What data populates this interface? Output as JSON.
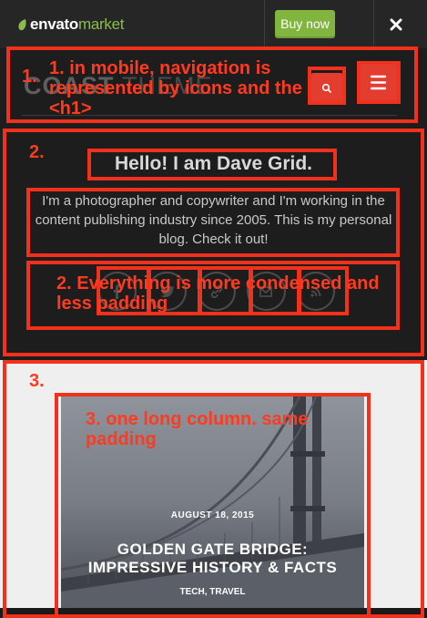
{
  "envato": {
    "logo_bold": "envato",
    "logo_light": "market",
    "buy_label": "Buy now"
  },
  "header": {
    "title_bold": "COAST",
    "title_light": "THEME"
  },
  "hero": {
    "title": "Hello! I am Dave Grid.",
    "text": "I'm a photographer and copywriter and I'm working in the content publishing industry since 2005. This is my personal blog. Check it out!",
    "social_icons": [
      "facebook-icon",
      "twitter-icon",
      "link-icon",
      "email-icon",
      "feed-icon"
    ]
  },
  "post": {
    "date": "AUGUST 18, 2015",
    "title": "GOLDEN GATE BRIDGE: IMPRESSIVE HISTORY & FACTS",
    "tags": "TECH, TRAVEL"
  },
  "annotations": {
    "n1": "1.",
    "t1": "1. in mobile, navigation is represented by icons and the <h1>",
    "n2": "2.",
    "t2": "2. Everything is more condensed and less padding",
    "n3": "3.",
    "t3": "3. one long column. same padding"
  },
  "colors": {
    "annotation": "#f2311c",
    "accent": "#e23d2f",
    "buy": "#82b440",
    "dark": "#1d1d1d"
  }
}
